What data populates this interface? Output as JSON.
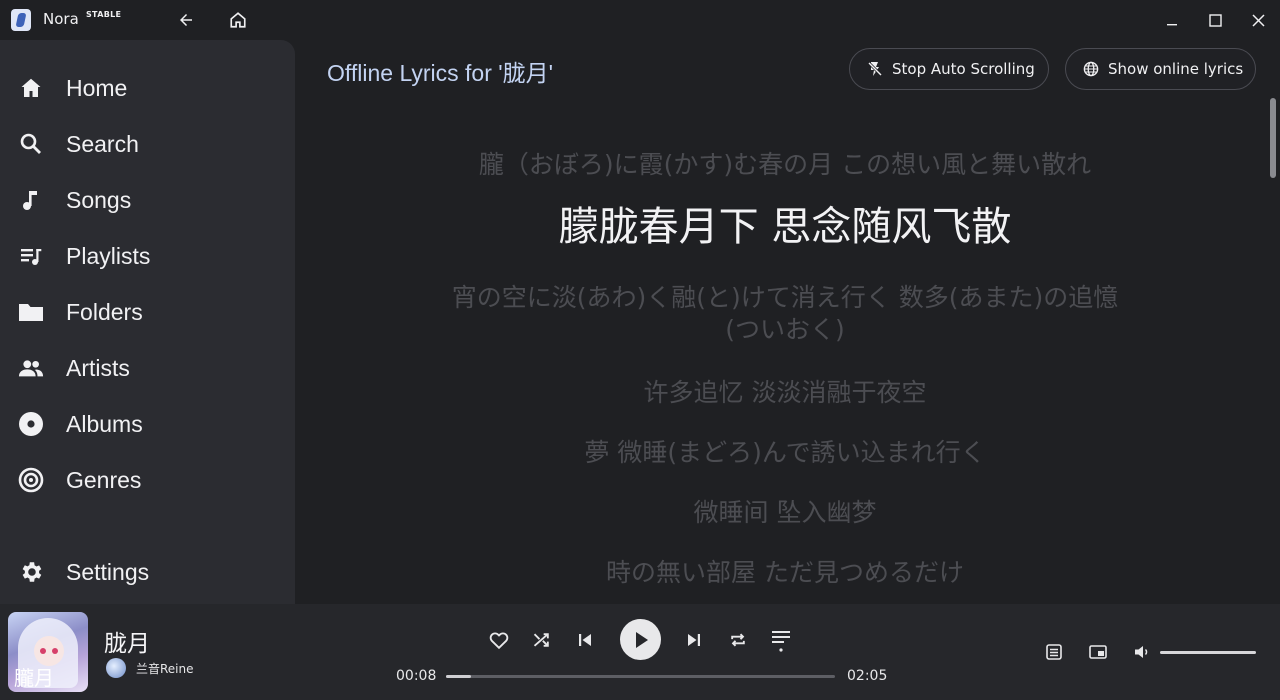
{
  "app": {
    "name": "Nora",
    "badge": "STABLE"
  },
  "sidebar": {
    "items": [
      {
        "label": "Home",
        "icon": "home-icon"
      },
      {
        "label": "Search",
        "icon": "search-icon"
      },
      {
        "label": "Songs",
        "icon": "music-note-icon"
      },
      {
        "label": "Playlists",
        "icon": "playlist-icon"
      },
      {
        "label": "Folders",
        "icon": "folder-icon"
      },
      {
        "label": "Artists",
        "icon": "people-icon"
      },
      {
        "label": "Albums",
        "icon": "album-icon"
      },
      {
        "label": "Genres",
        "icon": "genre-icon"
      }
    ],
    "settings": {
      "label": "Settings",
      "icon": "gear-icon"
    }
  },
  "lyrics": {
    "title": "Offline Lyrics for '胧月'",
    "stop_scroll_label": "Stop Auto Scrolling",
    "show_online_label": "Show online lyrics",
    "lines": [
      "朧（おぼろ)に霞(かす)む春の月 この想い風と舞い散れ",
      "朦胧春月下 思念随风飞散",
      "宵の空に淡(あわ)く融(と)けて消え行く 数多(あまた)の追憶(ついおく)",
      "许多追忆 淡淡消融于夜空",
      "夢 微睡(まどろ)んで誘い込まれ行く",
      "微睡间 坠入幽梦",
      "時の無い部屋 ただ見つめるだけ"
    ],
    "active_index": 1
  },
  "player": {
    "song_title": "胧月",
    "artist": "兰音Reine",
    "cover_text": "朧月",
    "current_time": "00:08",
    "total_time": "02:05",
    "progress": 0.064,
    "volume": 1.0
  },
  "colors": {
    "background": "#1f2023",
    "sidebar": "#2b2c31",
    "player": "#26272b",
    "title_accent": "#c3d3f2",
    "dim_lyric": "#4c4d52",
    "active_lyric": "#f2f2f4"
  }
}
